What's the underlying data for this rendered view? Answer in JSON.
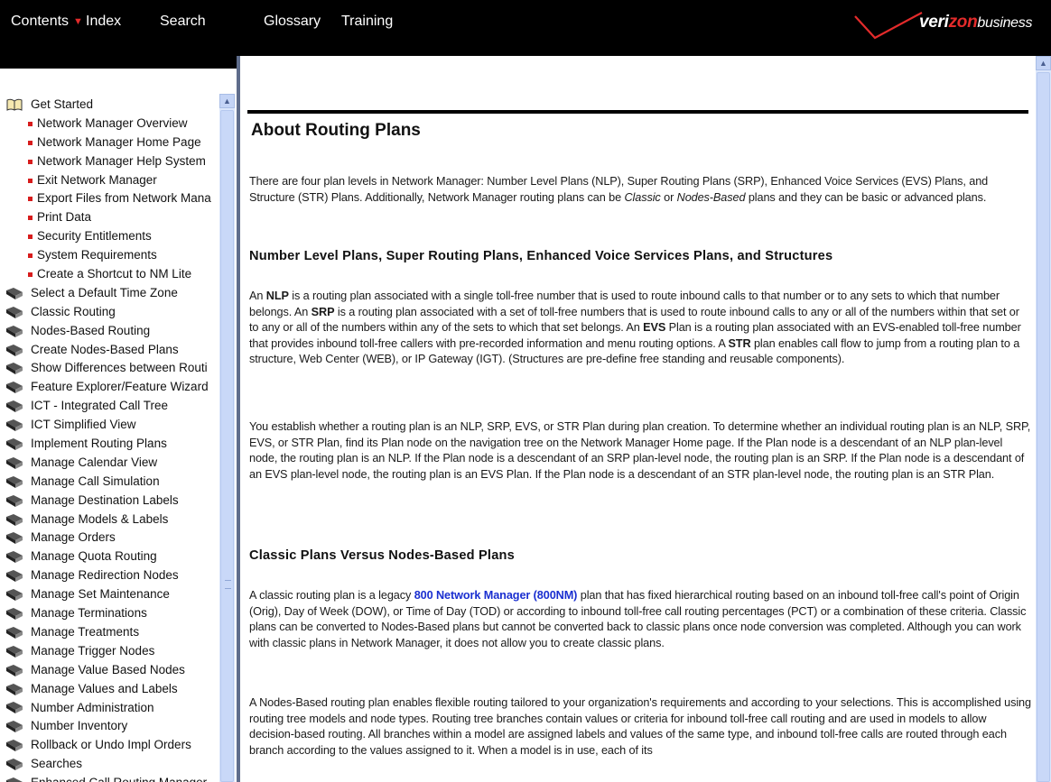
{
  "nav": {
    "contents": "Contents",
    "index": "Index",
    "search": "Search",
    "glossary": "Glossary",
    "training": "Training"
  },
  "logo": {
    "brand_a": "veri",
    "brand_z": "zon",
    "brand_suffix": "business"
  },
  "sidebar": {
    "items": [
      {
        "label": "Get Started",
        "type": "open-book"
      },
      {
        "label": "Network Manager Overview",
        "type": "child"
      },
      {
        "label": "Network Manager Home Page",
        "type": "child"
      },
      {
        "label": "Network Manager Help System",
        "type": "child"
      },
      {
        "label": "Exit Network Manager",
        "type": "child"
      },
      {
        "label": "Export Files from Network Mana",
        "type": "child"
      },
      {
        "label": "Print Data",
        "type": "child"
      },
      {
        "label": "Security Entitlements",
        "type": "child"
      },
      {
        "label": "System Requirements",
        "type": "child"
      },
      {
        "label": "Create a Shortcut to NM Lite",
        "type": "child"
      },
      {
        "label": "Select a Default Time Zone",
        "type": "book"
      },
      {
        "label": "Classic Routing",
        "type": "book"
      },
      {
        "label": "Nodes-Based Routing",
        "type": "book"
      },
      {
        "label": "Create Nodes-Based Plans",
        "type": "book"
      },
      {
        "label": "Show Differences between Routi",
        "type": "book"
      },
      {
        "label": "Feature Explorer/Feature Wizard",
        "type": "book"
      },
      {
        "label": "ICT - Integrated Call Tree",
        "type": "book"
      },
      {
        "label": "ICT Simplified View",
        "type": "book"
      },
      {
        "label": "Implement Routing Plans",
        "type": "book"
      },
      {
        "label": "Manage Calendar View",
        "type": "book"
      },
      {
        "label": "Manage Call Simulation",
        "type": "book"
      },
      {
        "label": "Manage Destination Labels",
        "type": "book"
      },
      {
        "label": "Manage Models & Labels",
        "type": "book"
      },
      {
        "label": "Manage Orders",
        "type": "book"
      },
      {
        "label": "Manage Quota Routing",
        "type": "book"
      },
      {
        "label": "Manage Redirection Nodes",
        "type": "book"
      },
      {
        "label": "Manage Set Maintenance",
        "type": "book"
      },
      {
        "label": "Manage Terminations",
        "type": "book"
      },
      {
        "label": "Manage Treatments",
        "type": "book"
      },
      {
        "label": "Manage Trigger Nodes",
        "type": "book"
      },
      {
        "label": "Manage Value Based Nodes",
        "type": "book"
      },
      {
        "label": "Manage Values and Labels",
        "type": "book"
      },
      {
        "label": "Number Administration",
        "type": "book"
      },
      {
        "label": "Number Inventory",
        "type": "book"
      },
      {
        "label": "Rollback or Undo Impl Orders",
        "type": "book"
      },
      {
        "label": "Searches",
        "type": "book"
      },
      {
        "label": "Enhanced Call Routing Manager",
        "type": "book"
      }
    ]
  },
  "content": {
    "title": "About Routing Plans",
    "intro": {
      "p1": "There are four plan levels in Network Manager: Number Level Plans (NLP), Super Routing Plans (SRP),  Enhanced Voice Services (EVS) Plans, and Structure (STR) Plans. Additionally, Network Manager routing plans can be ",
      "classic": "Classic",
      "p2": " or ",
      "nodes": "Nodes-Based",
      "p3": " plans and they can be basic or advanced plans."
    },
    "h_levels": "Number Level Plans, Super Routing Plans, Enhanced Voice Services Plans, and Structures",
    "levels": {
      "a": "An ",
      "nlp": "NLP",
      "b": " is a routing plan associated with a single toll-free number that is used to route inbound calls to that number or to any sets to which that number belongs. An ",
      "srp": "SRP",
      "c": " is a routing plan associated with a set of toll-free numbers that is used to route inbound calls to any or all of the numbers within that set or to any or all of the numbers within any of the sets to which that set belongs. An ",
      "evs": "EVS",
      "d": " Plan is a routing plan associated with an EVS-enabled toll-free number that provides inbound toll-free callers with pre-recorded information and menu routing options. A ",
      "str": "STR",
      "e": " plan enables call flow to jump from a routing plan to a structure, Web Center (WEB), or IP Gateway (IGT). (Structures are pre-define free standing and reusable components)."
    },
    "establish": "You establish whether a routing plan is an NLP, SRP, EVS, or STR Plan during plan creation. To determine whether an individual routing plan is an NLP, SRP, EVS, or STR Plan, find its Plan node on the navigation tree on the Network Manager Home page. If the Plan node is a descendant of an NLP plan-level node, the routing plan is an NLP. If the Plan node is a descendant of an SRP plan-level node, the routing plan is an SRP. If the Plan node is a descendant of an EVS plan-level node, the routing plan is an EVS Plan. If the Plan node is a descendant of an STR plan-level node, the routing plan is an STR Plan.",
    "h_classic": "Classic Plans Versus Nodes-Based Plans",
    "classic_para": {
      "a": "A classic routing plan is a legacy ",
      "link": "800 Network Manager (800NM)",
      "b": " plan that has fixed hierarchical routing based on an inbound toll-free call's point of Origin (Orig), Day of Week (DOW), or Time of Day (TOD) or according to inbound toll-free call routing percentages (PCT) or a combination of these criteria. Classic plans can be converted to Nodes-Based plans but cannot be converted back to classic plans once node conversion was completed. Although you can work with classic plans in Network Manager, it does not allow you to create classic plans."
    },
    "nodes_para": "A Nodes-Based routing plan enables flexible routing tailored to your organization's requirements and according to your selections. This is accomplished using routing tree models and node types. Routing tree branches contain values or criteria for inbound toll-free call routing and are used in models to allow decision-based routing. All branches within a model are assigned labels and values of the same type, and inbound toll-free calls are routed through each branch according to the values assigned to it. When a model is in use, each of its"
  }
}
